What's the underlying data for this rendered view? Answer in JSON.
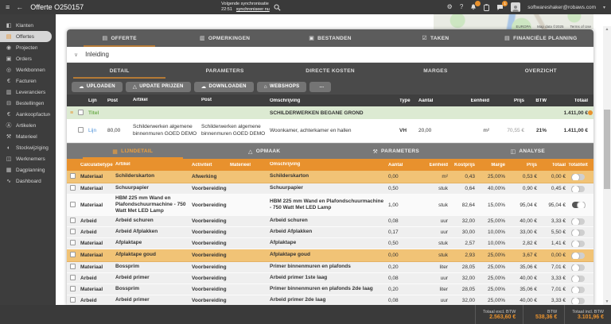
{
  "topbar": {
    "title": "Offerte O250157",
    "sync_label": "Volgende synchronisatie",
    "sync_time": "22:51",
    "sync_link": "synchroniseer nu",
    "account_email": "softwareshaker@robaws.com",
    "action_icons": [
      {
        "name": "print-icon",
        "glyph": "▤"
      },
      {
        "name": "mail-icon",
        "glyph": "✉"
      },
      {
        "name": "history-icon",
        "glyph": "◔"
      },
      {
        "name": "target-icon",
        "glyph": "◎"
      },
      {
        "name": "document-icon",
        "glyph": "▥"
      },
      {
        "name": "euro-icon",
        "glyph": "€"
      },
      {
        "name": "cart-icon",
        "glyph": "⊟"
      },
      {
        "name": "edit-icon",
        "glyph": "✎"
      }
    ],
    "right_icon_names": [
      "settings-icon",
      "help-icon",
      "notifications-icon",
      "clipboard-icon",
      "chat-icon",
      "avatar"
    ],
    "badges": {
      "notifications": "",
      "chat": "1"
    }
  },
  "map": {
    "region_label": "EUROPA",
    "attribution": "Map data ©2025",
    "terms": "Terms of Use"
  },
  "sidebar": {
    "items": [
      {
        "data_name": "sidebar-item-klanten",
        "label": "Klanten",
        "glyph": "◧",
        "state": ""
      },
      {
        "data_name": "sidebar-item-offertes",
        "label": "Offertes",
        "glyph": "▤",
        "state": "active"
      },
      {
        "data_name": "sidebar-item-projecten",
        "label": "Projecten",
        "glyph": "◉",
        "state": ""
      },
      {
        "data_name": "sidebar-item-orders",
        "label": "Orders",
        "glyph": "▣",
        "state": ""
      },
      {
        "data_name": "sidebar-item-werkbonnen",
        "label": "Werkbonnen",
        "glyph": "◎",
        "state": ""
      },
      {
        "data_name": "sidebar-item-facturen",
        "label": "Facturen",
        "glyph": "€",
        "state": ""
      },
      {
        "data_name": "sidebar-item-leveranciers",
        "label": "Leveranciers",
        "glyph": "▥",
        "state": ""
      },
      {
        "data_name": "sidebar-item-bestellingen",
        "label": "Bestellingen",
        "glyph": "⊟",
        "state": ""
      },
      {
        "data_name": "sidebar-item-aankoopfacturen",
        "label": "Aankoopfacturen",
        "glyph": "€",
        "state": ""
      },
      {
        "data_name": "sidebar-item-artikelen",
        "label": "Artikelen",
        "glyph": "Ⓐ",
        "state": ""
      },
      {
        "data_name": "sidebar-item-materieel",
        "label": "Materieel",
        "glyph": "⚒",
        "state": ""
      },
      {
        "data_name": "sidebar-item-stockwijziging",
        "label": "Stockwijziging",
        "glyph": "◐",
        "state": ""
      },
      {
        "data_name": "sidebar-item-werknemers",
        "label": "Werknemers",
        "glyph": "◫",
        "state": ""
      },
      {
        "data_name": "sidebar-item-dagplanning",
        "label": "Dagplanning",
        "glyph": "▦",
        "state": ""
      },
      {
        "data_name": "sidebar-item-dashboard",
        "label": "Dashboard",
        "glyph": "∿",
        "state": ""
      }
    ]
  },
  "tabs": [
    {
      "data_name": "tab-offerte",
      "label": "OFFERTE",
      "glyph": "▤",
      "state": "active"
    },
    {
      "data_name": "tab-opmerkingen",
      "label": "OPMERKINGEN",
      "glyph": "▥",
      "state": ""
    },
    {
      "data_name": "tab-bestanden",
      "label": "BESTANDEN",
      "glyph": "▣",
      "state": ""
    },
    {
      "data_name": "tab-taken",
      "label": "TAKEN",
      "glyph": "☑",
      "state": ""
    },
    {
      "data_name": "tab-financiele-planning",
      "label": "FINANCIËLE PLANNING",
      "glyph": "▤",
      "state": ""
    }
  ],
  "inleiding": {
    "title": "Inleiding",
    "chevron": "∨"
  },
  "subtabs": [
    {
      "data_name": "subtab-detail",
      "label": "DETAIL",
      "state": "active"
    },
    {
      "data_name": "subtab-parameters",
      "label": "PARAMETERS",
      "state": ""
    },
    {
      "data_name": "subtab-directe-kosten",
      "label": "DIRECTE KOSTEN",
      "state": ""
    },
    {
      "data_name": "subtab-marges",
      "label": "MARGES",
      "state": ""
    },
    {
      "data_name": "subtab-overzicht",
      "label": "OVERZICHT",
      "state": ""
    }
  ],
  "toolbar": [
    {
      "data_name": "uploaden-button",
      "label": "UPLOADEN",
      "glyph": "☁"
    },
    {
      "data_name": "update-prijzen-button",
      "label": "UPDATE PRIJZEN",
      "glyph": "△"
    },
    {
      "data_name": "downloaden-button",
      "label": "DOWNLOADEN",
      "glyph": "☁"
    },
    {
      "data_name": "webshops-button",
      "label": "WEBSHOPS",
      "glyph": "⌂"
    },
    {
      "data_name": "more-button",
      "label": "...",
      "glyph": ""
    }
  ],
  "table1": {
    "headers": [
      "Lijn",
      "Post",
      "Artikel",
      "Post",
      "Omschrijving",
      "Type",
      "Aantal",
      "Eenheid",
      "Prijs",
      "BTW",
      "Totaal"
    ],
    "titel_row": {
      "label": "Titel",
      "omschrijving": "SCHILDERWERKEN BEGANE GROND",
      "totaal": "1.411,00 €"
    },
    "lijn_row": {
      "label": "Lijn",
      "post": "80,00",
      "artikel": "Schilderwerken algemene binnenmuren GOED DEMO",
      "post2": "Schilderwerken algemene binnenmuren GOED DEMO",
      "omschrijving": "Woonkamer, achterkamer en hallen",
      "type": "VH",
      "aantal": "20,00",
      "eenheid": "m²",
      "prijs": "70,55 €",
      "btw": "21%",
      "totaal": "1.411,00 €"
    }
  },
  "section2": {
    "tabs": [
      {
        "data_name": "tab-lijndetail",
        "label": "LIJNDETAIL",
        "glyph": "▦",
        "state": "active"
      },
      {
        "data_name": "tab-opmaak",
        "label": "OPMAAK",
        "glyph": "△",
        "state": ""
      },
      {
        "data_name": "tab-parameters",
        "label": "PARAMETERS",
        "glyph": "⚒",
        "state": ""
      },
      {
        "data_name": "tab-analyse",
        "label": "ANALYSE",
        "glyph": "◫",
        "state": ""
      }
    ]
  },
  "table2": {
    "headers": [
      "Calculatietype",
      "Artikel",
      "Activiteit",
      "Materieel",
      "Omschrijving",
      "Aantal",
      "Eenheid",
      "Kostprijs",
      "Marge",
      "Prijs",
      "Totaal",
      "Totaliteit"
    ],
    "rows": [
      {
        "state": "hl",
        "type": "Materiaal",
        "artikel": "Schilderskarton",
        "activiteit": "Afwerking",
        "materieel": "",
        "omschrijving": "Schilderskarton",
        "aantal": "0,00",
        "eenheid": "m²",
        "kostprijs": "0,43",
        "marge": "25,00%",
        "prijs": "0,53 €",
        "totaal": "0,00 €",
        "toggle": "off"
      },
      {
        "state": "",
        "type": "Materiaal",
        "artikel": "Schuurpapier",
        "activiteit": "Voorbereiding",
        "materieel": "",
        "omschrijving": "Schuurpapier",
        "aantal": "0,50",
        "eenheid": "stuk",
        "kostprijs": "0,64",
        "marge": "40,00%",
        "prijs": "0,90 €",
        "totaal": "0,45 €",
        "toggle": "off"
      },
      {
        "state": "tall",
        "type": "Materiaal",
        "artikel": "HBM 225 mm Wand en Plafondschuurmachine - 750 Watt Met LED Lamp",
        "activiteit": "Voorbereiding",
        "materieel": "",
        "omschrijving": "HBM 225 mm Wand en Plafondschuurmachine - 750 Watt Met LED Lamp",
        "aantal": "1,00",
        "eenheid": "stuk",
        "kostprijs": "82,64",
        "marge": "15,00%",
        "prijs": "95,04 €",
        "totaal": "95,04 €",
        "toggle": "on"
      },
      {
        "state": "",
        "type": "Arbeid",
        "artikel": "Arbeid schuren",
        "activiteit": "Voorbereiding",
        "materieel": "",
        "omschrijving": "Arbeid schuren",
        "aantal": "0,08",
        "eenheid": "uur",
        "kostprijs": "32,00",
        "marge": "25,00%",
        "prijs": "40,00 €",
        "totaal": "3,33 €",
        "toggle": "off"
      },
      {
        "state": "",
        "type": "Arbeid",
        "artikel": "Arbeid Afplakken",
        "activiteit": "Voorbereiding",
        "materieel": "",
        "omschrijving": "Arbeid Afplakken",
        "aantal": "0,17",
        "eenheid": "uur",
        "kostprijs": "30,00",
        "marge": "10,00%",
        "prijs": "33,00 €",
        "totaal": "5,50 €",
        "toggle": "off"
      },
      {
        "state": "",
        "type": "Materiaal",
        "artikel": "Afplaktape",
        "activiteit": "Voorbereiding",
        "materieel": "",
        "omschrijving": "Afplaktape",
        "aantal": "0,50",
        "eenheid": "stuk",
        "kostprijs": "2,57",
        "marge": "10,00%",
        "prijs": "2,82 €",
        "totaal": "1,41 €",
        "toggle": "off"
      },
      {
        "state": "hl",
        "type": "Materiaal",
        "artikel": "Afplaktape goud",
        "activiteit": "Voorbereiding",
        "materieel": "",
        "omschrijving": "Afplaktape goud",
        "aantal": "0,00",
        "eenheid": "stuk",
        "kostprijs": "2,93",
        "marge": "25,00%",
        "prijs": "3,67 €",
        "totaal": "0,00 €",
        "toggle": "off"
      },
      {
        "state": "",
        "type": "Materiaal",
        "artikel": "Bossprim",
        "activiteit": "Voorbereiding",
        "materieel": "",
        "omschrijving": "Primer binnenmuren en plafonds",
        "aantal": "0,20",
        "eenheid": "liter",
        "kostprijs": "28,05",
        "marge": "25,00%",
        "prijs": "35,06 €",
        "totaal": "7,01 €",
        "toggle": "off"
      },
      {
        "state": "",
        "type": "Arbeid",
        "artikel": "Arbeid primer",
        "activiteit": "Voorbereiding",
        "materieel": "",
        "omschrijving": "Arbeid primer 1ste laag",
        "aantal": "0,08",
        "eenheid": "uur",
        "kostprijs": "32,00",
        "marge": "25,00%",
        "prijs": "40,00 €",
        "totaal": "3,33 €",
        "toggle": "off"
      },
      {
        "state": "",
        "type": "Materiaal",
        "artikel": "Bossprim",
        "activiteit": "Voorbereiding",
        "materieel": "",
        "omschrijving": "Primer binnenmuren en plafonds 2de laag",
        "aantal": "0,20",
        "eenheid": "liter",
        "kostprijs": "28,05",
        "marge": "25,00%",
        "prijs": "35,06 €",
        "totaal": "7,01 €",
        "toggle": "off"
      },
      {
        "state": "",
        "type": "Arbeid",
        "artikel": "Arbeid primer",
        "activiteit": "Voorbereiding",
        "materieel": "",
        "omschrijving": "Arbeid primer 2de laag",
        "aantal": "0,08",
        "eenheid": "uur",
        "kostprijs": "32,00",
        "marge": "25,00%",
        "prijs": "40,00 €",
        "totaal": "3,33 €",
        "toggle": "off"
      }
    ]
  },
  "footer": {
    "totals": [
      {
        "label": "Totaal excl. BTW",
        "value": "2.563,60 €"
      },
      {
        "label": "BTW",
        "value": "538,36 €"
      },
      {
        "label": "Totaal incl. BTW",
        "value": "3.101,96 €"
      }
    ]
  }
}
